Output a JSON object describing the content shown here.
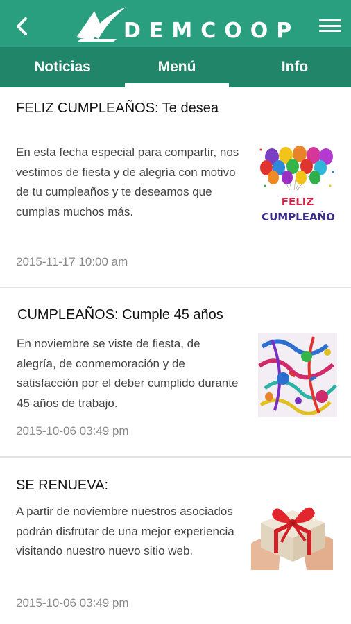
{
  "header": {
    "logo_text": "DEMCOOP",
    "back_icon": "chevron-left-icon",
    "menu_icon": "hamburger-menu-icon",
    "brand_color": "#2a9f80",
    "tab_color": "#208569"
  },
  "tabs": [
    {
      "label": "Noticias",
      "active": false
    },
    {
      "label": "Menú",
      "active": true
    },
    {
      "label": "Info",
      "active": false
    }
  ],
  "news": [
    {
      "title": "FELIZ CUMPLEAÑOS: Te desea",
      "body": "En esta fecha especial para compartir, nos vestimos de fiesta y de alegría con motivo de tu cumpleaños y te deseamos que cumplas muchos más.",
      "date": "2015-11-17 10:00 am",
      "image_caption_line1": "FELIZ",
      "image_caption_line2": "CUMPLEAÑO"
    },
    {
      "title": "CUMPLEAÑOS:  Cumple 45 años",
      "body": "En noviembre  se viste de fiesta, de alegría, de conmemoración y de satisfacción por el deber cumplido durante 45 años de trabajo.",
      "date": "2015-10-06 03:49 pm"
    },
    {
      "title": "SE RENUEVA:",
      "body": "A partir de noviembre nuestros asociados podrán disfrutar de una mejor experiencia visitando nuestro nuevo sitio web.",
      "date": "2015-10-06 03:49 pm"
    }
  ]
}
